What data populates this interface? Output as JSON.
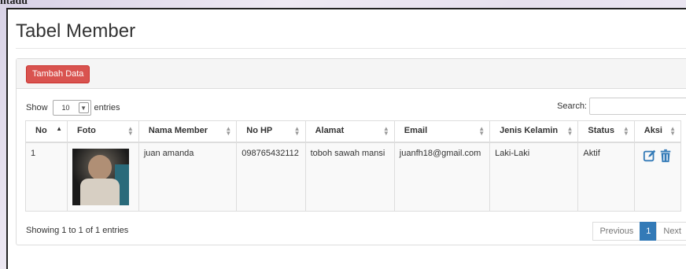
{
  "header": {
    "partial_bg_text": "ntadu",
    "page_title": "Tabel Member"
  },
  "panel": {
    "add_button": "Tambah Data"
  },
  "controls": {
    "show_label": "Show",
    "entries_value": "10",
    "entries_label": "entries",
    "search_label": "Search:",
    "search_value": ""
  },
  "table": {
    "columns": [
      "No",
      "Foto",
      "Nama Member",
      "No HP",
      "Alamat",
      "Email",
      "Jenis Kelamin",
      "Status",
      "Aksi"
    ],
    "rows": [
      {
        "no": "1",
        "nama": "juan amanda",
        "hp": "098765432112",
        "alamat": "toboh sawah mansi",
        "email": "juanfh18@gmail.com",
        "jenis_kelamin": "Laki-Laki",
        "status": "Aktif"
      }
    ],
    "sorted_column": "No",
    "action_icons": [
      "edit-icon",
      "trash-icon"
    ],
    "accent_color": "#337ab7",
    "add_button_color": "#d9534f"
  },
  "footer": {
    "info": "Showing 1 to 1 of 1 entries",
    "prev": "Previous",
    "page": "1",
    "next": "Next"
  }
}
